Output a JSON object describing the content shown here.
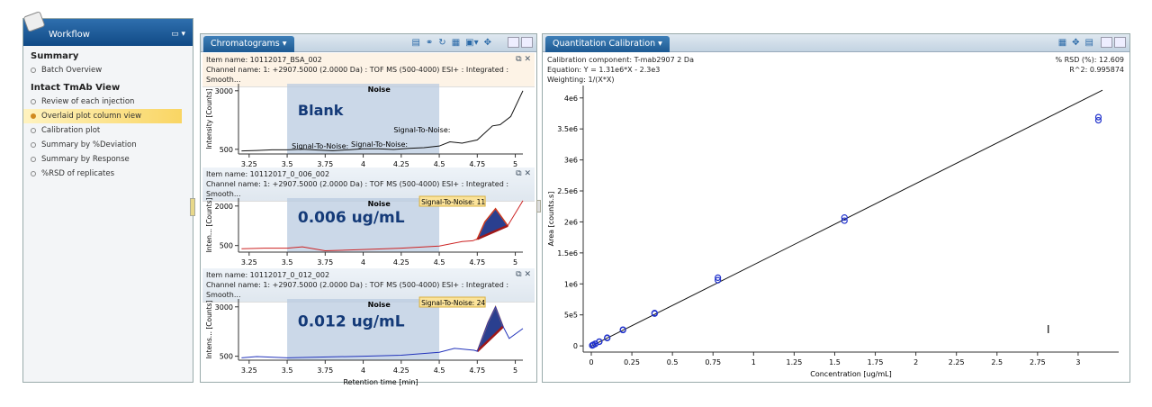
{
  "workflow": {
    "title": "Workflow",
    "sections": [
      {
        "label": "Summary",
        "items": [
          {
            "label": "Batch Overview",
            "active": false
          }
        ]
      },
      {
        "label": "Intact TmAb View",
        "items": [
          {
            "label": "Review of each injection",
            "active": false
          },
          {
            "label": "Overlaid plot column view",
            "active": true
          },
          {
            "label": "Calibration plot",
            "active": false
          },
          {
            "label": "Summary by %Deviation",
            "active": false
          },
          {
            "label": "Summary by Response",
            "active": false
          },
          {
            "label": "%RSD of replicates",
            "active": false
          }
        ]
      }
    ]
  },
  "chromatograms": {
    "title": "Chromatograms ▾",
    "x_label": "Retention time [min]",
    "x_ticks": [
      3.25,
      3.5,
      3.75,
      4,
      4.25,
      4.5,
      4.75,
      5
    ],
    "noise_label": "Noise",
    "panels": [
      {
        "item_name": "Item name: 10112017_BSA_002",
        "channel": "Channel name: 1: +2907.5000 (2.0000 Da) : TOF MS (500-4000) ESI+ : Integrated : Smooth...",
        "y_label": "Intensity [Counts]",
        "y_ticks": [
          500,
          3000
        ],
        "ylim": [
          300,
          3300
        ],
        "overlay": "Blank",
        "color": "#111111",
        "sn_labels": [
          "Signal-To-Noise:",
          "Signal-To-Noise:",
          "Signal-To-Noise:"
        ],
        "trace": [
          [
            3.2,
            430
          ],
          [
            3.3,
            450
          ],
          [
            3.4,
            480
          ],
          [
            3.5,
            480
          ],
          [
            3.6,
            500
          ],
          [
            3.7,
            470
          ],
          [
            3.8,
            440
          ],
          [
            3.9,
            480
          ],
          [
            4.0,
            520
          ],
          [
            4.1,
            520
          ],
          [
            4.2,
            490
          ],
          [
            4.3,
            540
          ],
          [
            4.4,
            570
          ],
          [
            4.5,
            640
          ],
          [
            4.57,
            820
          ],
          [
            4.65,
            760
          ],
          [
            4.75,
            900
          ],
          [
            4.85,
            1500
          ],
          [
            4.9,
            1550
          ],
          [
            4.97,
            1900
          ],
          [
            5.05,
            3000
          ]
        ]
      },
      {
        "item_name": "Item name: 10112017_0_006_002",
        "channel": "Channel name: 1: +2907.5000 (2.0000 Da) : TOF MS (500-4000) ESI+ : Integrated : Smooth...",
        "y_label": "Inten... [Counts]",
        "y_ticks": [
          500,
          2000
        ],
        "ylim": [
          250,
          2300
        ],
        "overlay": "0.006 ug/mL",
        "color": "#cc2222",
        "sn_labels": [
          "Signal-To-Noise: 11"
        ],
        "peak": [
          4.75,
          4.95
        ],
        "trace": [
          [
            3.2,
            380
          ],
          [
            3.35,
            400
          ],
          [
            3.5,
            400
          ],
          [
            3.6,
            450
          ],
          [
            3.75,
            300
          ],
          [
            4.0,
            350
          ],
          [
            4.25,
            400
          ],
          [
            4.5,
            480
          ],
          [
            4.65,
            650
          ],
          [
            4.72,
            680
          ],
          [
            4.75,
            750
          ],
          [
            4.8,
            1400
          ],
          [
            4.87,
            1900
          ],
          [
            4.92,
            1500
          ],
          [
            4.95,
            1250
          ],
          [
            5.05,
            2200
          ]
        ]
      },
      {
        "item_name": "Item name: 10112017_0_012_002",
        "channel": "Channel name: 1: +2907.5000 (2.0000 Da) : TOF MS (500-4000) ESI+ : Integrated : Smooth...",
        "y_label": "Intens... [Counts]",
        "y_ticks": [
          500,
          3000
        ],
        "ylim": [
          300,
          3400
        ],
        "overlay": "0.012 ug/mL",
        "color": "#2233bb",
        "sn_labels": [
          "Signal-To-Noise: 24"
        ],
        "peak": [
          4.75,
          4.95
        ],
        "trace": [
          [
            3.2,
            420
          ],
          [
            3.3,
            480
          ],
          [
            3.5,
            420
          ],
          [
            4.0,
            500
          ],
          [
            4.25,
            550
          ],
          [
            4.5,
            700
          ],
          [
            4.6,
            900
          ],
          [
            4.73,
            800
          ],
          [
            4.75,
            750
          ],
          [
            4.82,
            2200
          ],
          [
            4.87,
            3000
          ],
          [
            4.92,
            2000
          ],
          [
            4.96,
            1400
          ],
          [
            5.05,
            1900
          ]
        ]
      }
    ]
  },
  "calibration": {
    "title": "Quantitation Calibration ▾",
    "component": "Calibration component: T-mab2907 2 Da",
    "equation": "Equation: Y = 1.31e6*X - 2.3e3",
    "weighting": "Weighting: 1/(X*X)",
    "rsd": "% RSD (%): 12.609",
    "r2": "R^2: 0.995874"
  },
  "chart_data": {
    "type": "scatter",
    "xlabel": "Concentration [ug/mL]",
    "ylabel": "Area [counts.s]",
    "xlim": [
      -0.05,
      3.25
    ],
    "ylim": [
      -100000,
      4200000
    ],
    "x_ticks": [
      "0",
      "0.25",
      "0.5",
      "0.75",
      "1",
      "1.25",
      "1.5",
      "1.75",
      "2",
      "2.25",
      "2.5",
      "2.75",
      "3"
    ],
    "y_ticks": [
      "0",
      "5e5",
      "1e6",
      "1.5e6",
      "2e6",
      "2.5e6",
      "3e6",
      "3.5e6",
      "4e6"
    ],
    "fit": {
      "slope": 1310000,
      "intercept": -2300,
      "x_range": [
        0,
        3.15
      ]
    },
    "points": [
      [
        0.006,
        6000
      ],
      [
        0.006,
        9000
      ],
      [
        0.012,
        15000
      ],
      [
        0.012,
        18000
      ],
      [
        0.024,
        30000
      ],
      [
        0.024,
        35000
      ],
      [
        0.049,
        65000
      ],
      [
        0.049,
        70000
      ],
      [
        0.098,
        125000
      ],
      [
        0.098,
        132000
      ],
      [
        0.195,
        255000
      ],
      [
        0.195,
        262000
      ],
      [
        0.39,
        520000
      ],
      [
        0.39,
        530000
      ],
      [
        0.78,
        1060000
      ],
      [
        0.78,
        1100000
      ],
      [
        1.56,
        2020000
      ],
      [
        1.56,
        2070000
      ],
      [
        3.125,
        3640000
      ],
      [
        3.125,
        3690000
      ]
    ],
    "marker_color": "#2233cc",
    "line_color": "#111111"
  }
}
